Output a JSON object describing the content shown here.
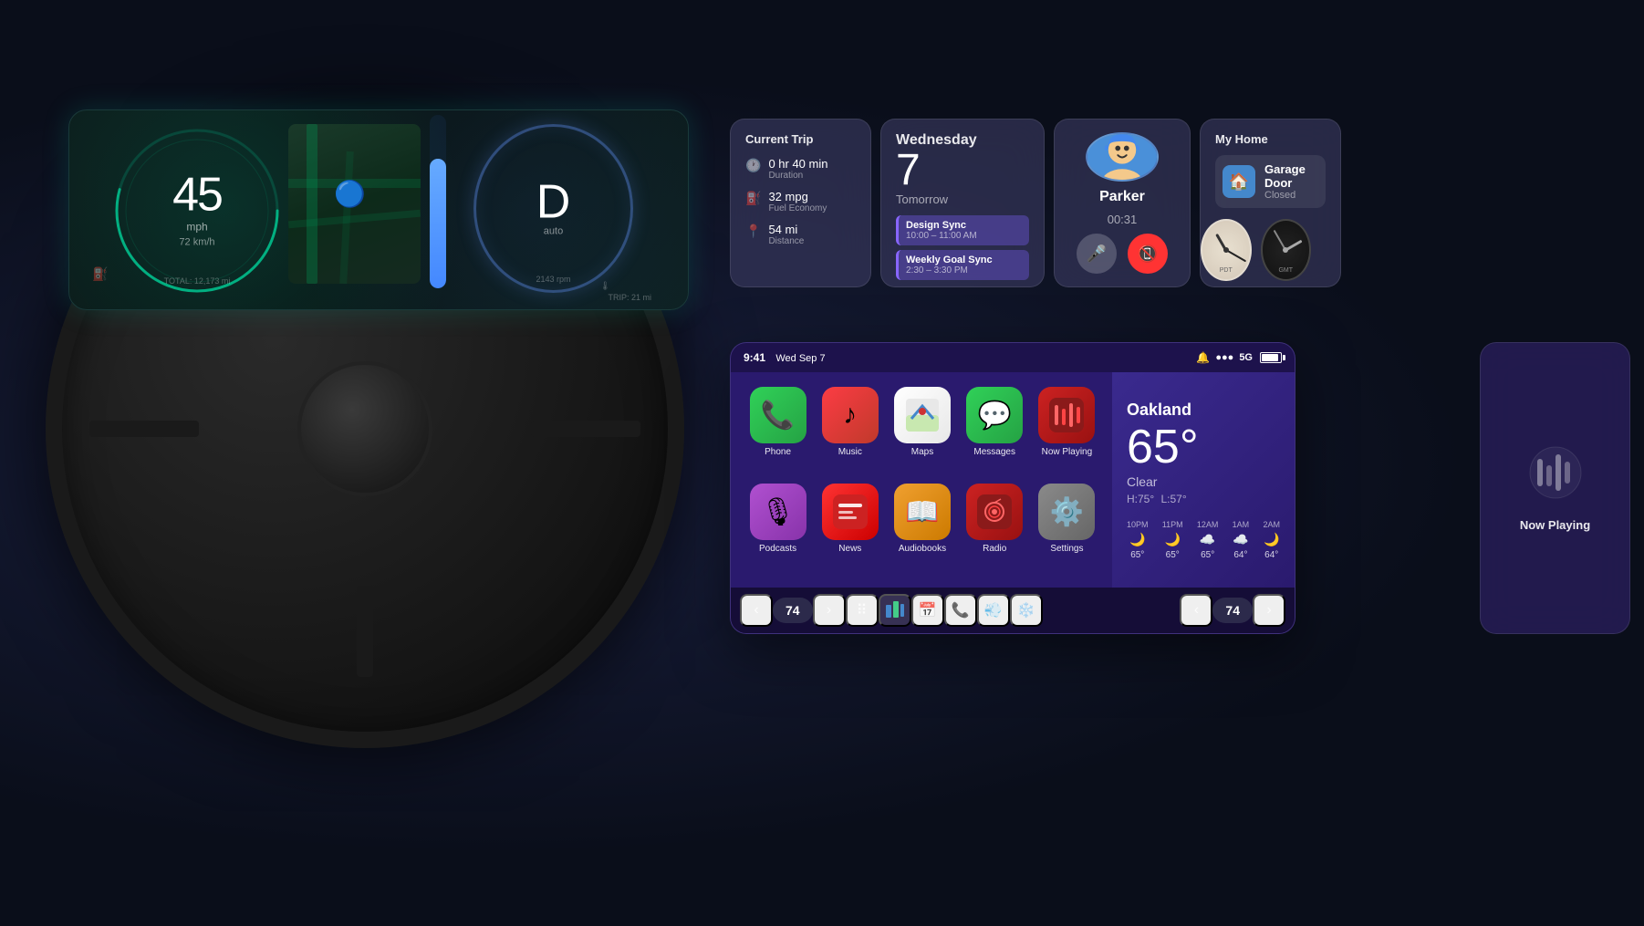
{
  "meta": {
    "title": "CarPlay Dashboard"
  },
  "dashboard": {
    "speed": "45",
    "speed_unit": "mph",
    "speed_kmh": "72 km/h",
    "gear": "D",
    "gear_sub": "auto",
    "rpm": "2143 rpm",
    "total_distance": "TOTAL: 12,173 mi"
  },
  "trip": {
    "title": "Current Trip",
    "duration_value": "0 hr 40 min",
    "duration_label": "Duration",
    "fuel_value": "32 mpg",
    "fuel_label": "Fuel Economy",
    "distance_value": "54 mi",
    "distance_label": "Distance"
  },
  "calendar": {
    "day_name": "Wednesday",
    "day_number": "7",
    "tomorrow_label": "Tomorrow",
    "events": [
      {
        "name": "Design Sync",
        "time": "10:00 – 11:00 AM"
      },
      {
        "name": "Weekly Goal Sync",
        "time": "2:30 – 3:30 PM"
      }
    ]
  },
  "contact": {
    "name": "Parker",
    "call_duration": "00:31"
  },
  "home": {
    "title": "My Home",
    "device_name": "Garage Door",
    "device_status": "Closed"
  },
  "weather": {
    "city": "Oakland",
    "temperature": "65°",
    "condition": "Clear",
    "high": "H:75°",
    "low": "L:57°",
    "hourly": [
      {
        "time": "10PM",
        "icon": "🌙",
        "temp": "65°"
      },
      {
        "time": "11PM",
        "icon": "🌙",
        "temp": "65°"
      },
      {
        "time": "12AM",
        "icon": "☁️",
        "temp": "65°"
      },
      {
        "time": "1AM",
        "icon": "☁️",
        "temp": "64°"
      },
      {
        "time": "2AM",
        "icon": "🌙",
        "temp": "64°"
      }
    ]
  },
  "status_bar": {
    "time": "9:41",
    "date": "Wed Sep 7",
    "network": "5G"
  },
  "apps": [
    {
      "name": "Phone",
      "icon": "📞",
      "class": "icon-phone"
    },
    {
      "name": "Music",
      "icon": "🎵",
      "class": "icon-music"
    },
    {
      "name": "Maps",
      "icon": "🗺️",
      "class": "icon-maps"
    },
    {
      "name": "Messages",
      "icon": "💬",
      "class": "icon-messages"
    },
    {
      "name": "Now Playing",
      "icon": "▶",
      "class": "icon-nowplaying"
    },
    {
      "name": "Podcasts",
      "icon": "🎙",
      "class": "icon-podcasts"
    },
    {
      "name": "News",
      "icon": "📰",
      "class": "icon-news"
    },
    {
      "name": "Audiobooks",
      "icon": "📖",
      "class": "icon-audiobooks"
    },
    {
      "name": "Radio",
      "icon": "📻",
      "class": "icon-radio"
    },
    {
      "name": "Settings",
      "icon": "⚙️",
      "class": "icon-settings"
    }
  ],
  "nav_bottom": {
    "temp": "74",
    "back_label": "‹",
    "forward_label": "›"
  },
  "now_playing_widget": {
    "label": "Now Playing"
  },
  "clocks": [
    {
      "label": "Clock 1"
    },
    {
      "label": "Clock 2"
    }
  ]
}
